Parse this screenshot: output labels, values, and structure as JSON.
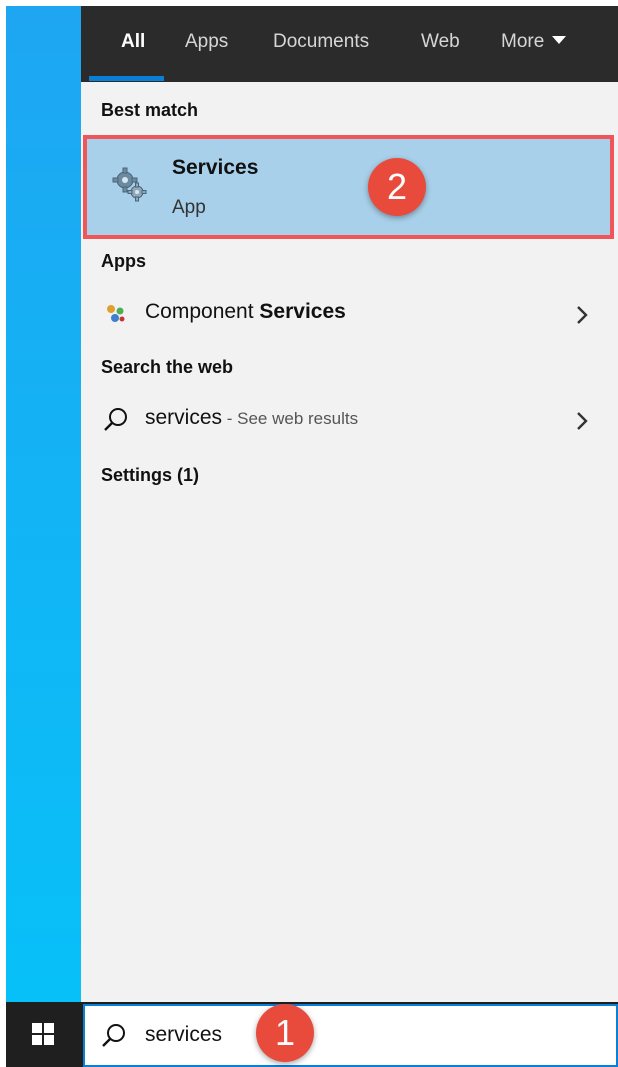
{
  "tabs": [
    {
      "label": "All",
      "active": true
    },
    {
      "label": "Apps"
    },
    {
      "label": "Documents"
    },
    {
      "label": "Web"
    },
    {
      "label": "More"
    }
  ],
  "sections": {
    "best_match": "Best match",
    "apps": "Apps",
    "web": "Search the web",
    "settings": "Settings (1)"
  },
  "best_match": {
    "title": "Services",
    "subtitle": "App",
    "icon": "gear-icon"
  },
  "apps": [
    {
      "prefix": "Component ",
      "highlight": "Services",
      "icon": "component-services-icon"
    }
  ],
  "web_results": [
    {
      "query": "services",
      "hint": " - See web results",
      "icon": "search-icon"
    }
  ],
  "annotations": {
    "step1": "1",
    "step2": "2",
    "color": "#e84b3c"
  },
  "taskbar": {
    "search_value": "services",
    "start_icon": "windows-logo-icon",
    "accent": "#0a7fd6"
  },
  "colors": {
    "highlight_bg": "#a8d0ea",
    "highlight_border": "#f0555a",
    "tabbar_bg": "#2b2b2b"
  }
}
